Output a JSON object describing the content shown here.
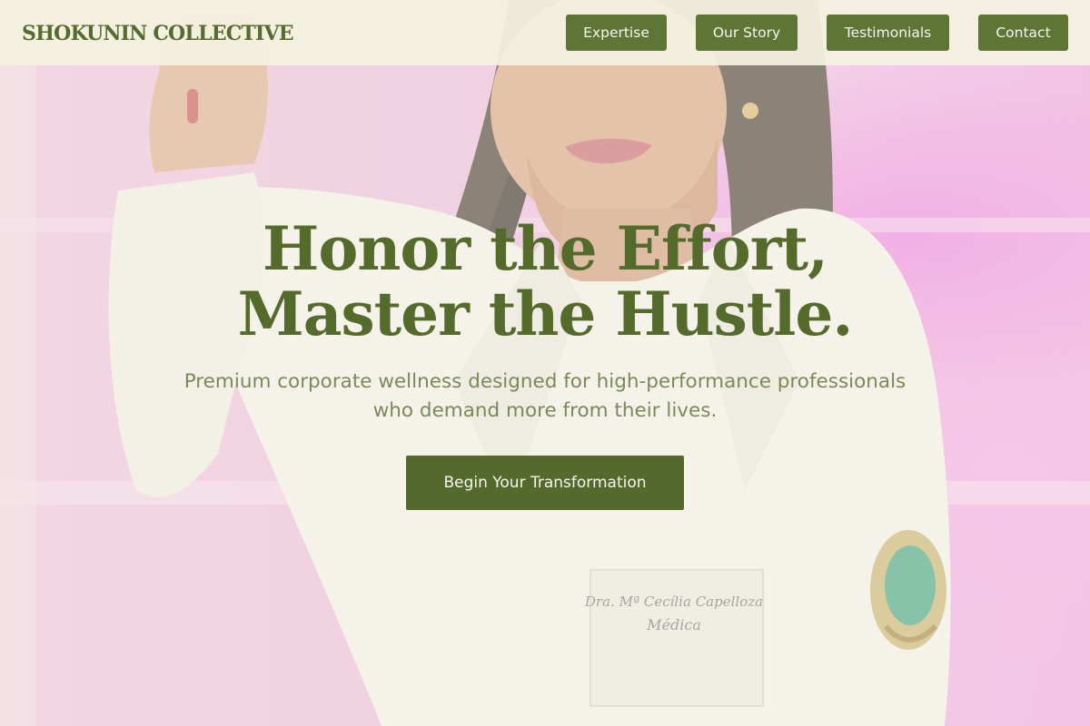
{
  "header": {
    "brand": "SHOKUNIN COLLECTIVE",
    "nav": [
      {
        "label": "Expertise"
      },
      {
        "label": "Our Story"
      },
      {
        "label": "Testimonials"
      },
      {
        "label": "Contact"
      }
    ]
  },
  "hero": {
    "headline_line1": "Honor the Effort,",
    "headline_line2": "Master the Hustle.",
    "subhead": "Premium corporate wellness designed for high-performance professionals who demand more from their lives.",
    "cta_label": "Begin Your Transformation",
    "photo": {
      "coat_embroidery_line1": "Dra. Mª Cecília Capelloza",
      "coat_embroidery_line2": "Médica"
    }
  },
  "colors": {
    "brand_green": "#556b2f",
    "button_green": "#5e7536",
    "header_bg": "#f4f2e0",
    "pink_bg": "#f1b5e6"
  }
}
